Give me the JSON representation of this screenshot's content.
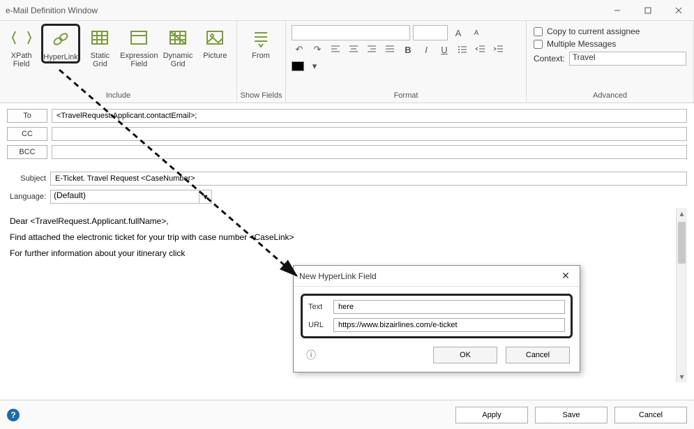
{
  "window": {
    "title": "e-Mail Definition Window"
  },
  "ribbon": {
    "include": {
      "label": "Include",
      "xpath_field": "XPath\nField",
      "hyperlink": "HyperLink",
      "static_grid": "Static\nGrid",
      "expression_field": "Expression\nField",
      "dynamic_grid": "Dynamic\nGrid",
      "picture": "Picture"
    },
    "showfields": {
      "label": "Show Fields",
      "from": "From"
    },
    "format": {
      "label": "Format"
    },
    "advanced": {
      "label": "Advanced",
      "copy_current": "Copy to current assignee",
      "multiple_msgs": "Multiple Messages",
      "context_label": "Context:",
      "context_value": "Travel"
    }
  },
  "form": {
    "to_label": "To",
    "to_value": "<TravelRequest.Applicant.contactEmail>;",
    "cc_label": "CC",
    "cc_value": "",
    "bcc_label": "BCC",
    "bcc_value": "",
    "subject_label": "Subject",
    "subject_value": "E-Ticket. Travel Request <CaseNumber>",
    "language_label": "Language:",
    "language_value": "(Default)"
  },
  "editor": {
    "line1": "Dear <TravelRequest.Applicant.fullName>,",
    "line2": "Find attached the electronic ticket for your trip with case number <CaseLink>",
    "line3": "For further information about your itinerary click"
  },
  "dialog": {
    "title": "New HyperLink Field",
    "text_label": "Text",
    "text_value": "here",
    "url_label": "URL",
    "url_value": "https://www.bizairlines.com/e-ticket",
    "ok": "OK",
    "cancel": "Cancel"
  },
  "footer": {
    "apply": "Apply",
    "save": "Save",
    "cancel": "Cancel"
  }
}
